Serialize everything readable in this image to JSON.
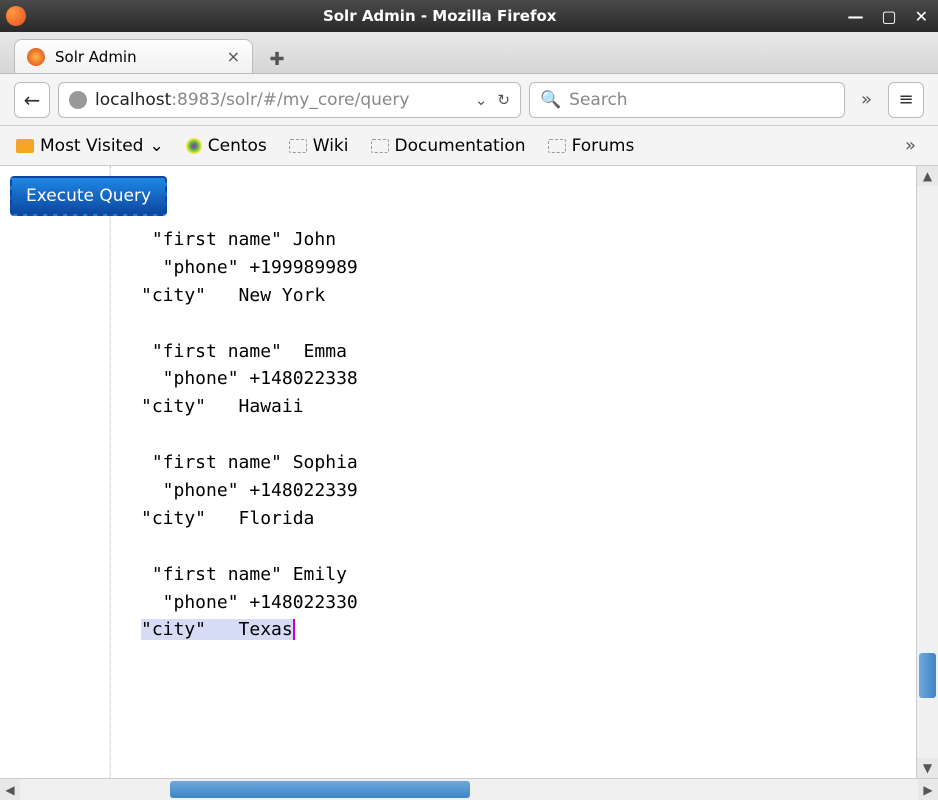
{
  "window": {
    "title": "Solr Admin - Mozilla Firefox"
  },
  "tab": {
    "label": "Solr Admin"
  },
  "url": {
    "host": "localhost",
    "port_path": ":8983/solr/#/my_core/query"
  },
  "searchbar": {
    "placeholder": "Search"
  },
  "bookmarks": {
    "most_visited": "Most Visited",
    "centos": "Centos",
    "wiki": "Wiki",
    "documentation": "Documentation",
    "forums": "Forums"
  },
  "main": {
    "execute_label": "Execute Query",
    "records": [
      {
        "first_name": "John",
        "phone": "+199989989",
        "city": "New York"
      },
      {
        "first_name": "Emma",
        "phone": "+148022338",
        "city": "Hawaii"
      },
      {
        "first_name": "Sophia",
        "phone": "+148022339",
        "city": "Florida"
      },
      {
        "first_name": "Emily",
        "phone": "+148022330",
        "city": "Texas"
      }
    ],
    "fields": {
      "first_name_label": "\"first name\"",
      "phone_label": "\"phone\"",
      "city_label": "\"city\""
    }
  }
}
